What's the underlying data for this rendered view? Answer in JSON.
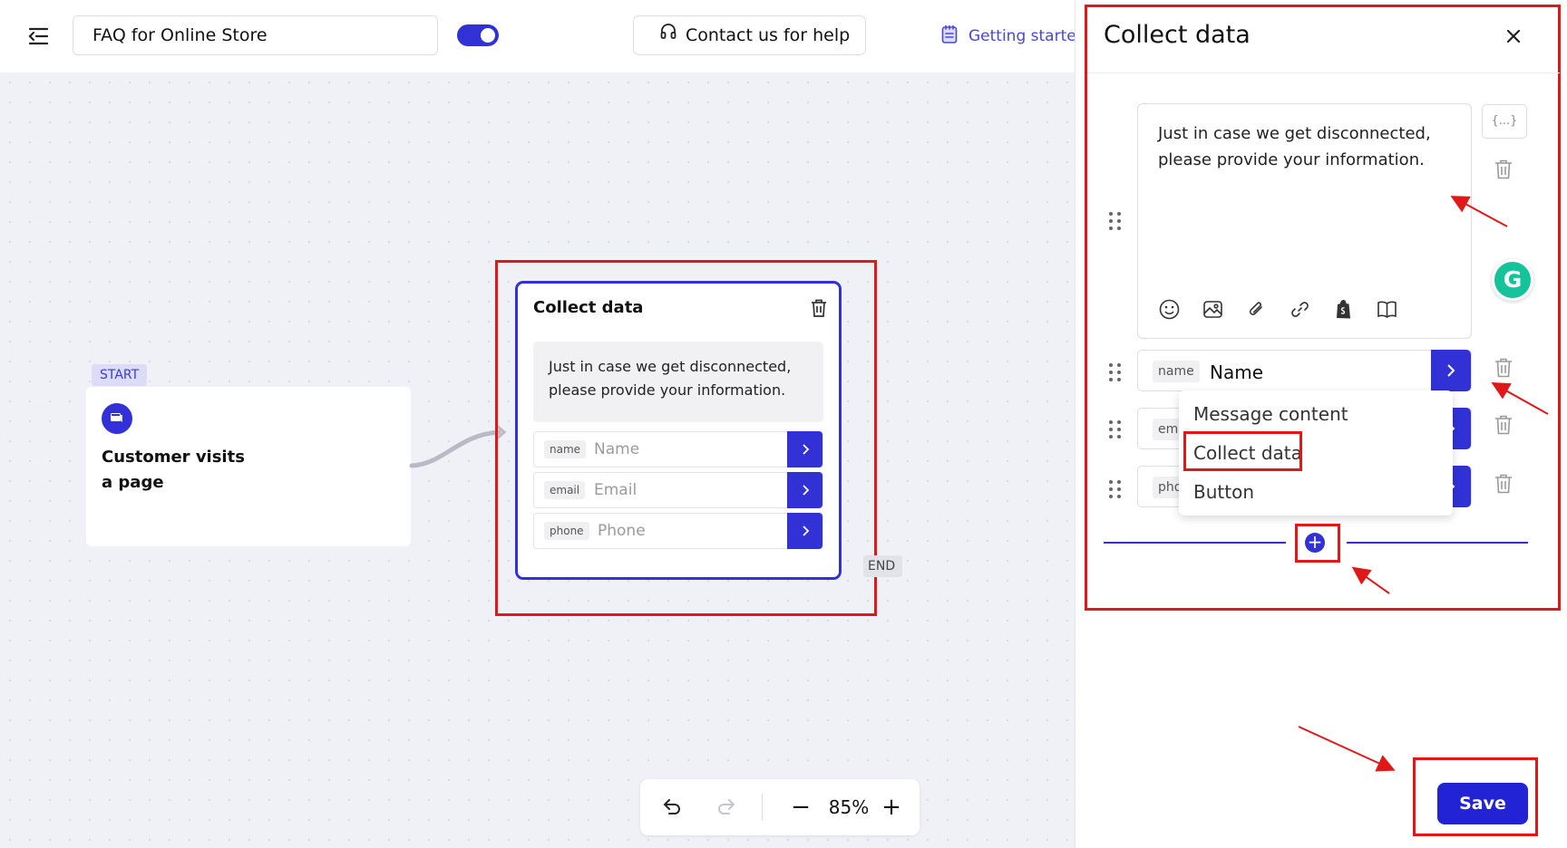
{
  "topbar": {
    "menu_icon": "menu-collapse-icon",
    "flow_title": "FAQ for Online Store",
    "toggle_state": "on",
    "help_label": "Contact us for help",
    "help_icon": "headset-icon",
    "getting_started_label": "Getting started",
    "getting_started_icon": "notes-icon"
  },
  "canvas": {
    "start_badge": "START",
    "start_card": {
      "icon": "chat-icon",
      "title": "Customer visits a page"
    },
    "node": {
      "title": "Collect data",
      "message": "Just in case we get disconnected, please provide your information.",
      "fields": [
        {
          "tag": "name",
          "placeholder": "Name"
        },
        {
          "tag": "email",
          "placeholder": "Email"
        },
        {
          "tag": "phone",
          "placeholder": "Phone"
        }
      ]
    },
    "end_badge": "END"
  },
  "zoom": {
    "level": "85%",
    "minus": "−",
    "plus": "+"
  },
  "panel": {
    "title": "Collect data",
    "message": "Just in case we get disconnected, please provide your information.",
    "variable_button": "{...}",
    "toolbar_icons": [
      "emoji-icon",
      "image-icon",
      "attachment-icon",
      "link-icon",
      "shopify-icon",
      "book-icon"
    ],
    "fields": [
      {
        "tag": "name",
        "value": "Name"
      },
      {
        "tag": "em",
        "value": ""
      },
      {
        "tag": "pho",
        "value": ""
      }
    ],
    "dropdown": {
      "items": [
        "Message content",
        "Collect data",
        "Button"
      ],
      "highlighted": "Collect data"
    },
    "add_button": "+",
    "grammarly_label": "G",
    "save_label": "Save"
  },
  "colors": {
    "accent": "#3131d6",
    "annotation_red": "#e01818",
    "canvas_bg": "#f0f1f6"
  }
}
